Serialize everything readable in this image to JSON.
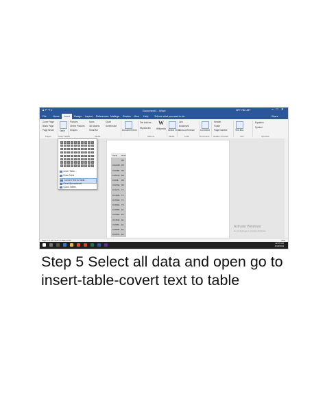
{
  "window": {
    "title": "Document1 - Word",
    "account": "NP7 7B2-JBT",
    "quick_access": "■ ↶ ↷ ▾"
  },
  "ribbon_tabs": [
    "File",
    "Home",
    "Insert",
    "Design",
    "Layout",
    "References",
    "Mailings",
    "Review",
    "View",
    "Help",
    "Tell me what you want to do",
    "Share"
  ],
  "active_tab": "Insert",
  "ribbon": {
    "pages": [
      "Cover Page",
      "Blank Page",
      "Page Break"
    ],
    "table_label": "Table",
    "illustrations": [
      "Pictures",
      "Online Pictures",
      "Shapes"
    ],
    "illustrations2": [
      "Icons",
      "3D Models",
      "SmartArt"
    ],
    "illustrations3": [
      "Chart",
      "Screenshot"
    ],
    "document_item": "Document Item",
    "addins": [
      "Get Add-ins",
      "My Add-ins"
    ],
    "wikipedia": "Wikipedia",
    "online_video": "Online Video",
    "links": [
      "Link",
      "Bookmark",
      "Cross-reference"
    ],
    "comment": "Comment",
    "header_footer": [
      "Header",
      "Footer",
      "Page Number"
    ],
    "text_box": "Text Box",
    "symbols": [
      "Equation",
      "Symbol"
    ],
    "groups": [
      "Pages",
      "Insert Tables",
      "Media",
      "Add-ins",
      "Media",
      "Links",
      "Comments",
      "Header & Footer",
      "Text",
      "Symbols"
    ]
  },
  "table_menu": {
    "items": [
      "Insert Table...",
      "Draw Table",
      "Convert Text to Table...",
      "Excel Spreadsheet",
      "Quick Tables"
    ],
    "highlighted_index": 2
  },
  "table_column": {
    "header": [
      "Table",
      "ROD"
    ],
    "rows": [
      [
        "",
        "R4"
      ],
      [
        "0.02045",
        "R5"
      ],
      [
        "0.0908L",
        "R6"
      ],
      [
        "0.0821L",
        "R6"
      ],
      [
        "0.063L",
        "R6"
      ],
      [
        "0.0253L",
        "R6"
      ],
      [
        "0.1127L",
        "T1"
      ],
      [
        "0.1422L",
        "T1"
      ],
      [
        "0.1542L",
        "T1"
      ],
      [
        "0.1894L",
        "T6"
      ],
      [
        "0.1895L",
        "E1"
      ],
      [
        "0.2096L",
        "E1"
      ],
      [
        "0.2454L",
        "E1"
      ],
      [
        "0.2685",
        "E1"
      ],
      [
        "0.2883L",
        "E1"
      ],
      [
        "0.3067L",
        "E1"
      ]
    ]
  },
  "watermark": {
    "line1": "Activate Windows",
    "line2": "Go to Settings to activate Windows."
  },
  "statusbar": {
    "left": "Page 1 of 137    7143 of 7556 words",
    "right": "90%"
  },
  "taskbar": {
    "time": "12:25 PM",
    "date": "1/18/2019"
  },
  "caption": {
    "step": "Step 5",
    "text": " Select all data and open go to insert-table-covert text to table"
  },
  "colors": {
    "word_blue": "#2b579a",
    "ribbon_bg": "#f3f3f3",
    "taskbar": "#1e1e1e",
    "menu_highlight": "#cde0f7"
  }
}
